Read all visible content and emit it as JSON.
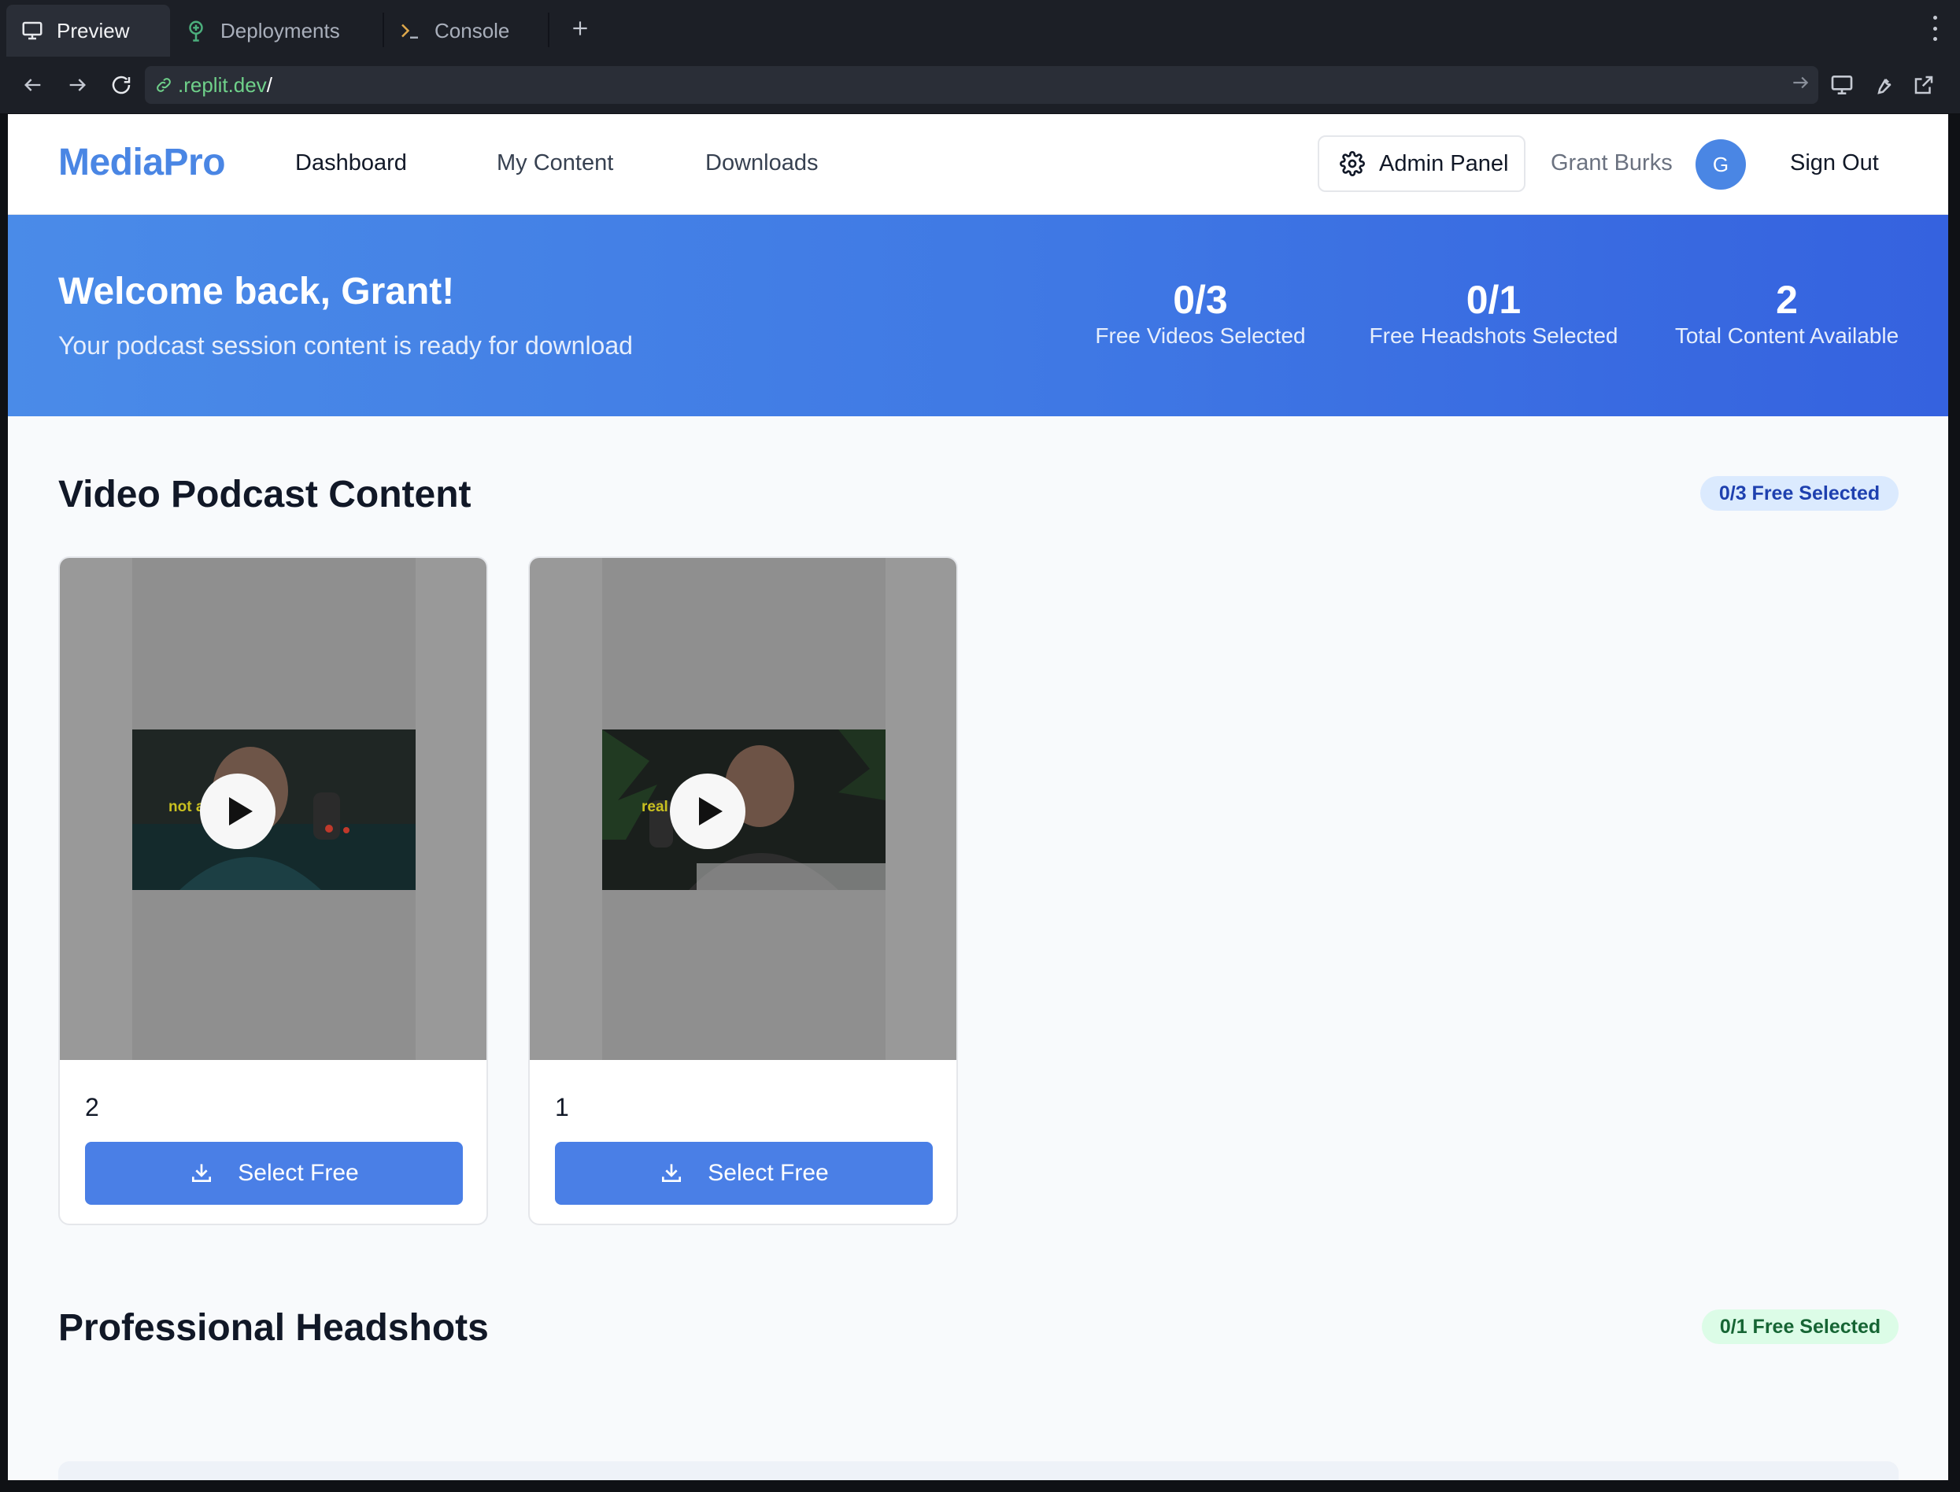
{
  "browser": {
    "tabs": [
      {
        "label": "Preview",
        "icon": "monitor-icon"
      },
      {
        "label": "Deployments",
        "icon": "deploy-icon"
      },
      {
        "label": "Console",
        "icon": "terminal-icon"
      }
    ],
    "new_tab_icon": "plus-icon",
    "url": {
      "domain": ".replit.dev",
      "path": "/"
    }
  },
  "nav": {
    "logo": "MediaPro",
    "links": [
      "Dashboard",
      "My Content",
      "Downloads"
    ],
    "admin_label": "Admin Panel",
    "user_name": "Grant Burks",
    "avatar_initial": "G",
    "sign_out": "Sign Out"
  },
  "hero": {
    "title": "Welcome back, Grant!",
    "subtitle": "Your podcast session content is ready for download",
    "stats": [
      {
        "value": "0/3",
        "label": "Free Videos Selected"
      },
      {
        "value": "0/1",
        "label": "Free Headshots Selected"
      },
      {
        "value": "2",
        "label": "Total Content Available"
      }
    ]
  },
  "videos": {
    "title": "Video Podcast Content",
    "badge": "0/3 Free Selected",
    "items": [
      {
        "title": "2",
        "button": "Select Free",
        "caption": "not al"
      },
      {
        "title": "1",
        "button": "Select Free",
        "caption": "real e gagent"
      }
    ]
  },
  "headshots": {
    "title": "Professional Headshots",
    "badge": "0/1 Free Selected"
  },
  "colors": {
    "brand": "#4a86e4",
    "hero_start": "#4a8be8",
    "hero_end": "#3562df",
    "button": "#4a7fe6"
  }
}
